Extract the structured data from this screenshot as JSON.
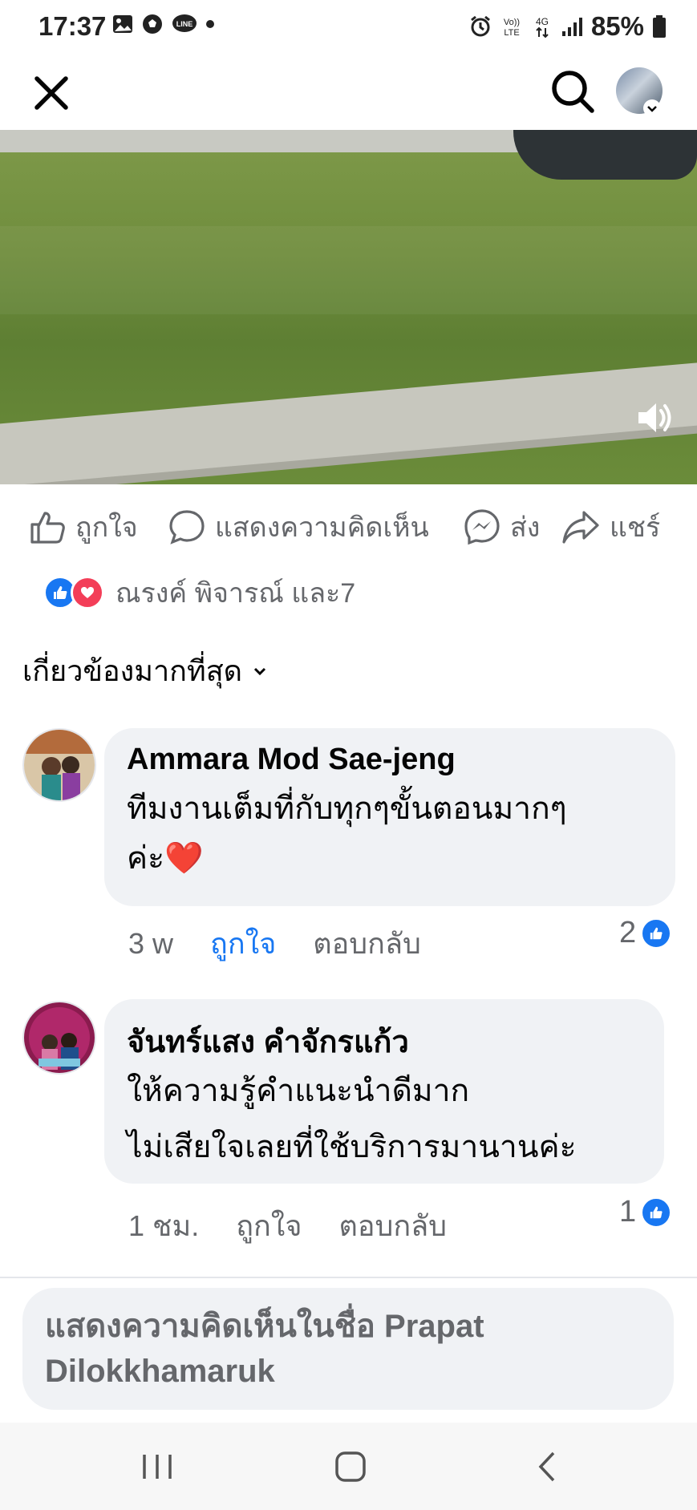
{
  "status_bar": {
    "time": "17:37",
    "battery": "85%",
    "icons": [
      "gallery-icon",
      "soccer-ball-icon",
      "line-app-icon",
      "dot-icon",
      "alarm-icon",
      "volte-icon",
      "4g-icon",
      "signal-icon",
      "battery-icon"
    ]
  },
  "top_nav": {
    "close_icon": "close-icon",
    "search_icon": "search-icon",
    "profile_icon": "avatar"
  },
  "actions": {
    "like": "ถูกใจ",
    "comment": "แสดงความคิดเห็น",
    "send": "ส่ง",
    "share": "แชร์"
  },
  "reactions": {
    "summary": "ณรงค์ พิจารณ์ และ7"
  },
  "sort": {
    "label": "เกี่ยวข้องมากที่สุด"
  },
  "comments": [
    {
      "author": "Ammara Mod Sae-jeng",
      "text": "ทีมงานเต็มที่กับทุกๆขั้นตอนมากๆ\nค่ะ❤️",
      "time": "3 w",
      "like_label": "ถูกใจ",
      "reply_label": "ตอบกลับ",
      "like_count": "2",
      "liked": true
    },
    {
      "author": "จันทร์แสง คำจักรแก้ว",
      "text": "ให้ความรู้คำแนะนำดีมาก\nไม่เสียใจเลยที่ใช้บริการมานานค่ะ",
      "time": "1 ชม.",
      "like_label": "ถูกใจ",
      "reply_label": "ตอบกลับ",
      "like_count": "1",
      "liked": false
    }
  ],
  "composer": {
    "placeholder": "แสดงความคิดเห็นในชื่อ Prapat Dilokkhamaruk"
  },
  "nav_bar": {
    "icons": [
      "recent-apps-icon",
      "home-icon",
      "back-icon"
    ]
  },
  "colors": {
    "accent": "#1877f2",
    "love": "#f33e58",
    "secondary_text": "#65676b",
    "bubble": "#f0f2f5"
  }
}
